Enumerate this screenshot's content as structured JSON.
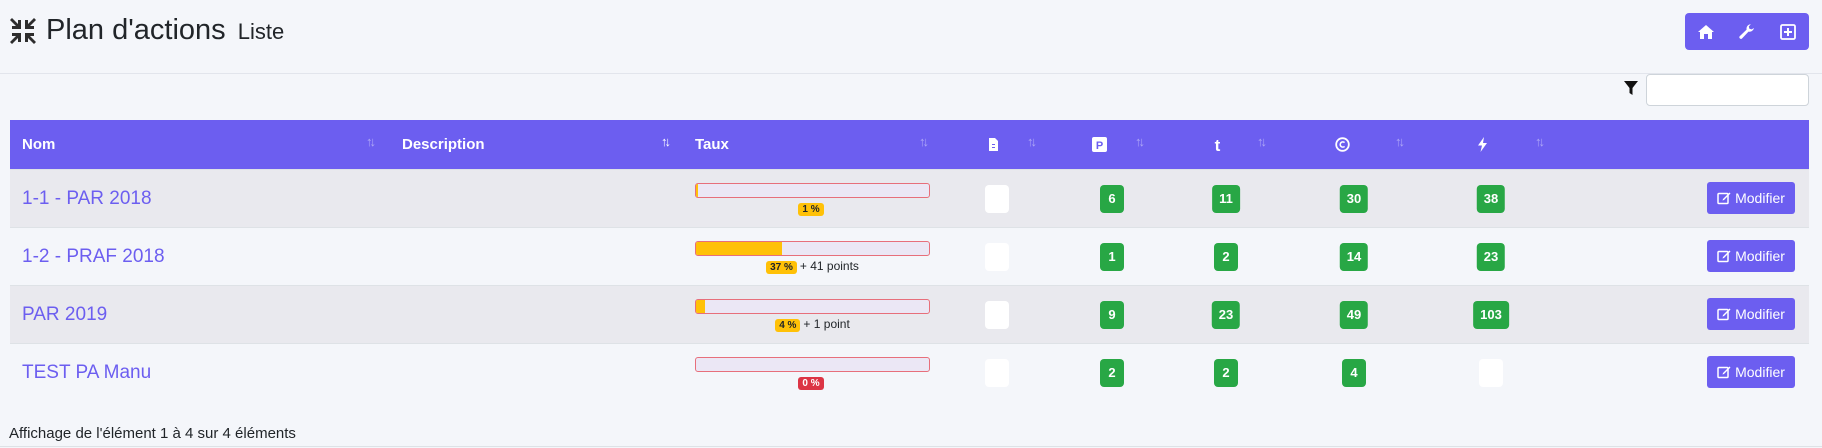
{
  "header": {
    "title": "Plan d'actions",
    "subtitle": "Liste",
    "title_icon": "compress-icon",
    "buttons": [
      {
        "icon": "home-icon"
      },
      {
        "icon": "wrench-icon"
      },
      {
        "icon": "plus-square-icon"
      }
    ]
  },
  "filter": {
    "icon": "filter-icon",
    "value": "",
    "placeholder": ""
  },
  "table": {
    "columns": [
      {
        "label": "Nom",
        "sort": "none"
      },
      {
        "label": "Description",
        "sort": "asc"
      },
      {
        "label": "Taux",
        "sort": "none"
      },
      {
        "icon": "document-icon",
        "sort": "none"
      },
      {
        "icon": "parking-icon",
        "sort": "none"
      },
      {
        "icon": "tumblr-icon",
        "sort": "none"
      },
      {
        "icon": "copyright-icon",
        "sort": "none"
      },
      {
        "icon": "bolt-icon",
        "sort": "none"
      }
    ],
    "rows": [
      {
        "nom": "1-1 - PAR 2018",
        "description": "",
        "taux": 1,
        "taux_label": "1 %",
        "points": "",
        "doc": "",
        "p": "6",
        "t": "11",
        "c": "30",
        "bolt": "38",
        "action": "Modifier"
      },
      {
        "nom": "1-2 - PRAF 2018",
        "description": "",
        "taux": 37,
        "taux_label": "37 %",
        "points": "+ 41 points",
        "doc": "",
        "p": "1",
        "t": "2",
        "c": "14",
        "bolt": "23",
        "action": "Modifier"
      },
      {
        "nom": "PAR 2019",
        "description": "",
        "taux": 4,
        "taux_label": "4 %",
        "points": "+ 1 point",
        "doc": "",
        "p": "9",
        "t": "23",
        "c": "49",
        "bolt": "103",
        "action": "Modifier"
      },
      {
        "nom": "TEST PA Manu",
        "description": "",
        "taux": 0,
        "taux_label": "0 %",
        "points": "",
        "doc": "",
        "p": "2",
        "t": "2",
        "c": "4",
        "bolt": "",
        "action": "Modifier"
      }
    ]
  },
  "footer": {
    "info": "Affichage de l'élément 1 à 4 sur 4 éléments"
  },
  "colors": {
    "primary": "#6c5ef0",
    "success": "#28a745",
    "warning": "#ffc107",
    "danger": "#dc3545"
  }
}
